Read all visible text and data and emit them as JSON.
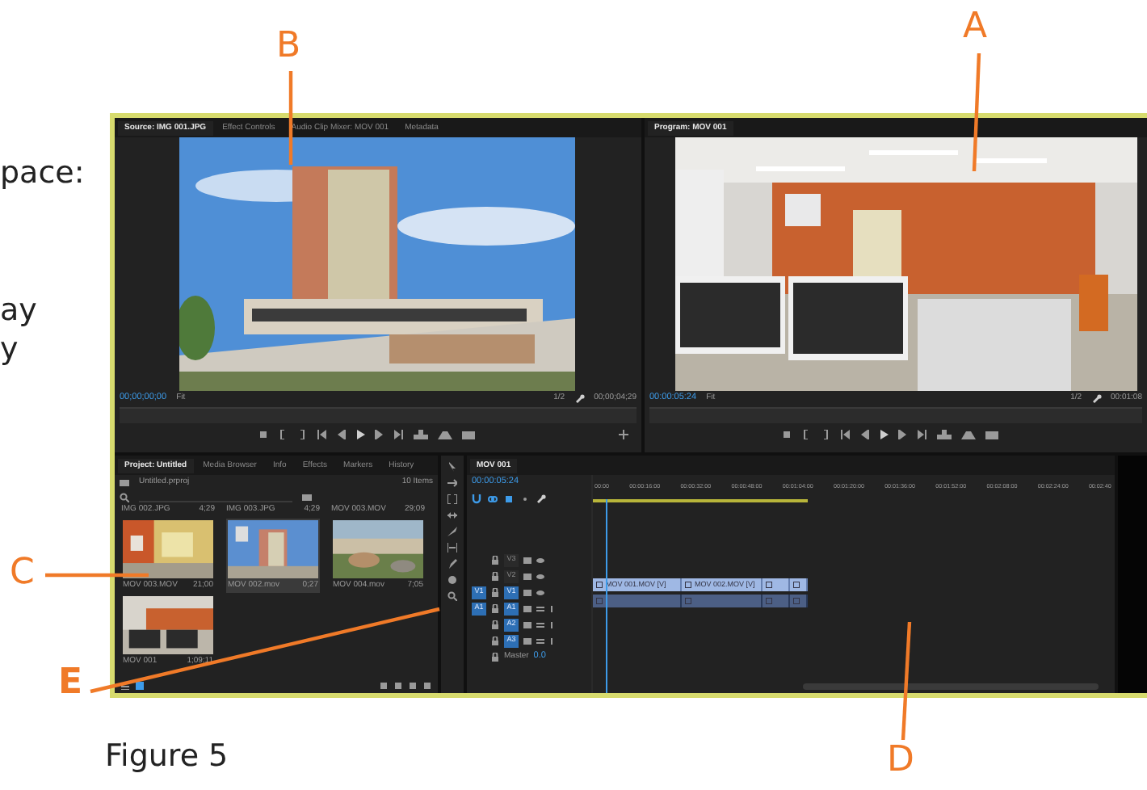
{
  "figure": {
    "side_text": [
      {
        "text": "pace:"
      },
      {
        "text": "ay"
      },
      {
        "text": "y"
      }
    ],
    "caption": "Figure 5"
  },
  "callouts": [
    {
      "label": "B"
    },
    {
      "label": "A"
    },
    {
      "label": "C"
    },
    {
      "label": "E"
    },
    {
      "label": "D"
    }
  ],
  "source_monitor": {
    "tabs": [
      {
        "label": "Source: IMG 001.JPG",
        "selected": true
      },
      {
        "label": "Effect Controls",
        "selected": false
      },
      {
        "label": "Audio Clip Mixer: MOV 001",
        "selected": false
      },
      {
        "label": "Metadata",
        "selected": false
      }
    ],
    "timecode": "00;00;00;00",
    "zoom": "Fit",
    "resolution": "1/2",
    "duration": "00;00;04;29"
  },
  "program_monitor": {
    "tabs": [
      {
        "label": "Program: MOV 001",
        "selected": true
      }
    ],
    "timecode": "00:00:05:24",
    "zoom": "Fit",
    "resolution": "1/2",
    "duration": "00:01:08"
  },
  "project_panel": {
    "tabs": [
      {
        "label": "Project: Untitled",
        "selected": true
      },
      {
        "label": "Media Browser",
        "selected": false
      },
      {
        "label": "Info",
        "selected": false
      },
      {
        "label": "Effects",
        "selected": false
      },
      {
        "label": "Markers",
        "selected": false
      },
      {
        "label": "History",
        "selected": false
      }
    ],
    "file": "Untitled.prproj",
    "count": "10 Items",
    "header_row": [
      {
        "name": "IMG 002.JPG",
        "duration": "4;29"
      },
      {
        "name": "IMG 003.JPG",
        "duration": "4;29"
      },
      {
        "name": "MOV 003.MOV",
        "duration": "29;09"
      }
    ],
    "items": [
      {
        "name": "MOV 003.MOV",
        "duration": "21;00",
        "selected": false
      },
      {
        "name": "MOV 002.mov",
        "duration": "0;27",
        "selected": true
      },
      {
        "name": "MOV 004.mov",
        "duration": "7;05",
        "selected": false
      },
      {
        "name": "MOV 001",
        "duration": "1;09;11",
        "selected": false
      }
    ]
  },
  "timeline": {
    "tabs": [
      {
        "label": "MOV 001",
        "selected": true
      }
    ],
    "timecode": "00:00:05:24",
    "ruler": [
      "00:00",
      "00:00:16:00",
      "00:00:32:00",
      "00:00:48:00",
      "00:01:04:00",
      "00:01:20:00",
      "00:01:36:00",
      "00:01:52:00",
      "00:02:08:00",
      "00:02:24:00",
      "00:02:40"
    ],
    "tracks": [
      {
        "name": "V3",
        "kind": "video",
        "targeted": false
      },
      {
        "name": "V2",
        "kind": "video",
        "targeted": false
      },
      {
        "name": "V1",
        "kind": "video",
        "targeted": true,
        "source_patch": "V1"
      },
      {
        "name": "A1",
        "kind": "audio",
        "targeted": true,
        "source_patch": "A1"
      },
      {
        "name": "A2",
        "kind": "audio",
        "targeted": true
      },
      {
        "name": "A3",
        "kind": "audio",
        "targeted": true
      },
      {
        "name": "Master",
        "kind": "master",
        "value": "0.0"
      }
    ],
    "video_clips": [
      {
        "kind": "labeled",
        "label": "MOV 001.MOV [V]"
      },
      {
        "kind": "labeled",
        "label": "MOV 002.MOV [V]"
      },
      {
        "kind": "short"
      },
      {
        "kind": "short"
      }
    ],
    "audio_clips": [
      {
        "kind": "short"
      },
      {
        "kind": "short"
      },
      {
        "kind": "short"
      },
      {
        "kind": "short"
      }
    ]
  }
}
